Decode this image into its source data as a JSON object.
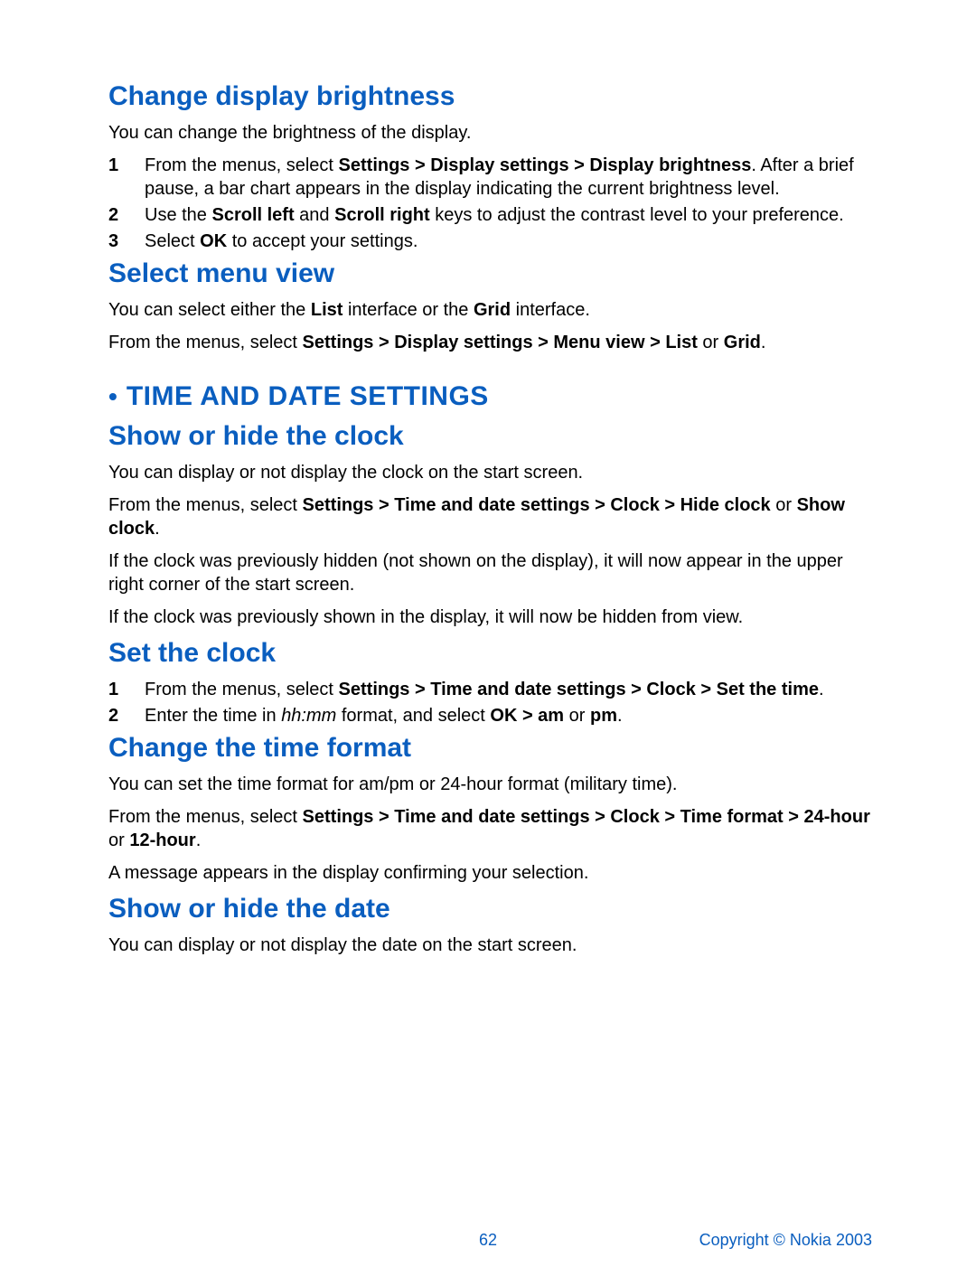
{
  "s1": {
    "title": "Change display brightness",
    "p1": "You can change the brightness of the display.",
    "steps": {
      "n1": "1",
      "t1a": "From the menus, select ",
      "t1b": "Settings > Display settings > Display brightness",
      "t1c": ". After a brief pause, a bar chart appears in the display indicating the current brightness level.",
      "n2": "2",
      "t2a": "Use the ",
      "t2b": "Scroll left",
      "t2c": " and ",
      "t2d": "Scroll right",
      "t2e": " keys to adjust the contrast level to your preference.",
      "n3": "3",
      "t3a": "Select ",
      "t3b": "OK",
      "t3c": " to accept your settings."
    }
  },
  "s2": {
    "title": "Select menu view",
    "p1a": "You can select either the ",
    "p1b": "List",
    "p1c": " interface or the ",
    "p1d": "Grid",
    "p1e": " interface.",
    "p2a": "From the menus, select ",
    "p2b": "Settings > Display settings > Menu view > List",
    "p2c": " or ",
    "p2d": "Grid",
    "p2e": "."
  },
  "sec": {
    "bullet": "•",
    "title": "TIME AND DATE SETTINGS"
  },
  "s3": {
    "title": "Show or hide the clock",
    "p1": "You can display or not display the clock on the start screen.",
    "p2a": "From the menus, select ",
    "p2b": "Settings > Time and date settings > Clock > Hide clock",
    "p2c": " or ",
    "p2d": "Show clock",
    "p2e": ".",
    "p3": "If the clock was previously hidden (not shown on the display), it will now appear in the upper right corner of the start screen.",
    "p4": "If the clock was previously shown in the display, it will now be hidden from view."
  },
  "s4": {
    "title": "Set the clock",
    "steps": {
      "n1": "1",
      "t1a": "From the menus, select ",
      "t1b": "Settings > Time and date settings > Clock > Set the time",
      "t1c": ".",
      "n2": "2",
      "t2a": "Enter the time in ",
      "t2b": "hh:mm",
      "t2c": " format, and select ",
      "t2d": "OK > am",
      "t2e": " or ",
      "t2f": "pm",
      "t2g": "."
    }
  },
  "s5": {
    "title": "Change the time format",
    "p1": "You can set the time format for am/pm or 24-hour format (military time).",
    "p2a": "From the menus, select ",
    "p2b": "Settings > Time and date settings > Clock > Time format > 24-hour",
    "p2c": " or ",
    "p2d": "12-hour",
    "p2e": ".",
    "p3": "A message appears in the display confirming your selection."
  },
  "s6": {
    "title": "Show or hide the date",
    "p1": "You can display or not display the date on the start screen."
  },
  "footer": {
    "page": "62",
    "copy": "Copyright © Nokia 2003"
  }
}
